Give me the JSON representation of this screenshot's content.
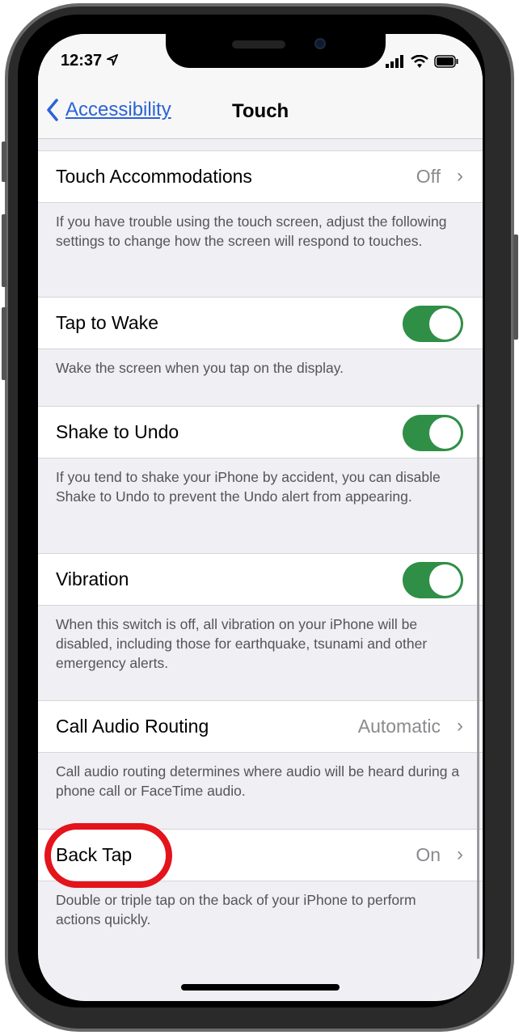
{
  "status": {
    "time": "12:37",
    "location_icon": "location-arrow-icon",
    "signal_icon": "cellular-signal-icon",
    "wifi_icon": "wifi-icon",
    "battery_icon": "battery-icon"
  },
  "nav": {
    "back_label": "Accessibility",
    "title": "Touch"
  },
  "rows": [
    {
      "label": "Touch Accommodations",
      "value": "Off",
      "desc": "If you have trouble using the touch screen, adjust the following settings to change how the screen will respond to touches."
    },
    {
      "label": "Tap to Wake",
      "toggle": true,
      "desc": "Wake the screen when you tap on the display."
    },
    {
      "label": "Shake to Undo",
      "toggle": true,
      "desc": "If you tend to shake your iPhone by accident, you can disable Shake to Undo to prevent the Undo alert from appearing."
    },
    {
      "label": "Vibration",
      "toggle": true,
      "desc": "When this switch is off, all vibration on your iPhone will be disabled, including those for earthquake, tsunami and other emergency alerts."
    },
    {
      "label": "Call Audio Routing",
      "value": "Automatic",
      "desc": "Call audio routing determines where audio will be heard during a phone call or FaceTime audio."
    },
    {
      "label": "Back Tap",
      "value": "On",
      "desc": "Double or triple tap on the back of your iPhone to perform actions quickly."
    }
  ],
  "colors": {
    "accent": "#2a63d6",
    "toggle_on": "#2f8f46",
    "highlight_circle": "#e3141b"
  }
}
